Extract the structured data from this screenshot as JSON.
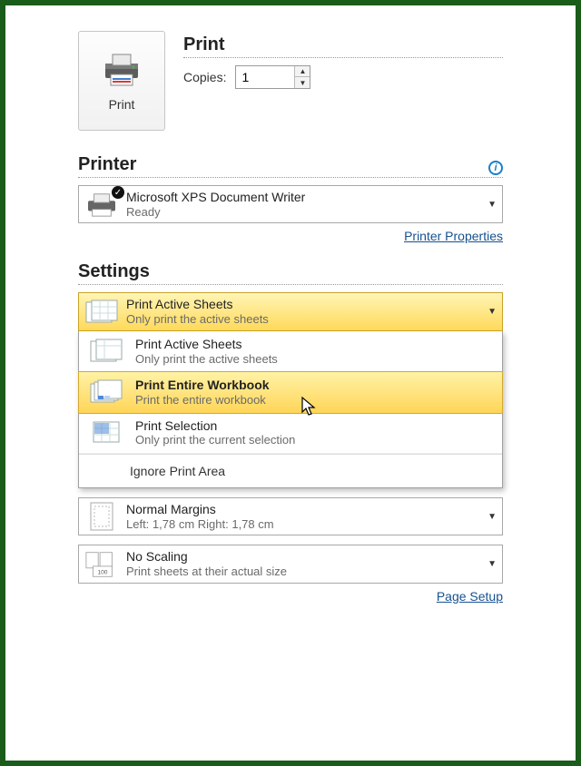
{
  "print_button": {
    "label": "Print"
  },
  "print_header": {
    "title": "Print",
    "copies_label": "Copies:",
    "copies_value": "1"
  },
  "printer": {
    "section_title": "Printer",
    "name": "Microsoft XPS Document Writer",
    "status": "Ready",
    "properties_link": "Printer Properties"
  },
  "settings": {
    "section_title": "Settings",
    "selected": {
      "title": "Print Active Sheets",
      "sub": "Only print the active sheets"
    },
    "options": [
      {
        "title": "Print Active Sheets",
        "sub": "Only print the active sheets",
        "icon": "sheets",
        "highlight": false
      },
      {
        "title": "Print Entire Workbook",
        "sub": "Print the entire workbook",
        "icon": "workbook",
        "highlight": true
      },
      {
        "title": "Print Selection",
        "sub": "Only print the current selection",
        "icon": "selection",
        "highlight": false
      }
    ],
    "ignore_label": "Ignore Print Area",
    "margins": {
      "title": "Normal Margins",
      "sub": "Left: 1,78 cm   Right: 1,78 cm"
    },
    "scaling": {
      "title": "No Scaling",
      "sub": "Print sheets at their actual size"
    },
    "page_setup_link": "Page Setup"
  }
}
